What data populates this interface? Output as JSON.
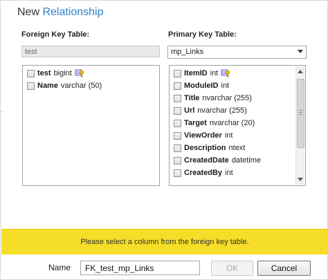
{
  "dialog": {
    "title_prefix": "New ",
    "title_accent": "Relationship",
    "accent_color": "#2f7fc7"
  },
  "foreign_key": {
    "label": "Foreign Key Table:",
    "table_value": "test",
    "columns": [
      {
        "name": "test",
        "type": "bigint",
        "primary_key": true
      },
      {
        "name": "Name",
        "type": "varchar (50)",
        "primary_key": false
      }
    ]
  },
  "primary_key": {
    "label": "Primary Key Table:",
    "selected_table": "mp_Links",
    "columns": [
      {
        "name": "ItemID",
        "type": "int",
        "primary_key": true
      },
      {
        "name": "ModuleID",
        "type": "int",
        "primary_key": false
      },
      {
        "name": "Title",
        "type": "nvarchar (255)",
        "primary_key": false
      },
      {
        "name": "Url",
        "type": "nvarchar (255)",
        "primary_key": false
      },
      {
        "name": "Target",
        "type": "nvarchar (20)",
        "primary_key": false
      },
      {
        "name": "ViewOrder",
        "type": "int",
        "primary_key": false
      },
      {
        "name": "Description",
        "type": "ntext",
        "primary_key": false
      },
      {
        "name": "CreatedDate",
        "type": "datetime",
        "primary_key": false
      },
      {
        "name": "CreatedBy",
        "type": "int",
        "primary_key": false
      }
    ]
  },
  "banner": {
    "message": "Please select a column from the foreign key table.",
    "color": "#f6dd28"
  },
  "footer": {
    "name_label": "Name",
    "name_value": "FK_test_mp_Links",
    "ok_label": "OK",
    "cancel_label": "Cancel"
  }
}
